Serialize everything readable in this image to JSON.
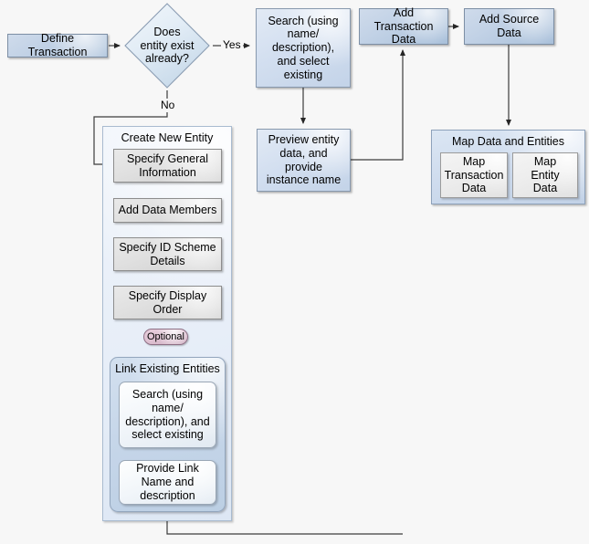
{
  "diagram": {
    "title": "Define Transaction workflow",
    "colors": {
      "background": "#f7f7f7",
      "line": "#3c3c3c",
      "box_blue": "#c2d2e6",
      "box_blue_lite": "#d3dff0",
      "box_grey": "#e0e0e0",
      "container_create": "#e7eef8",
      "container_link": "#c6d6e9",
      "container_map": "#cfdcee",
      "optional_pill": "#ddbfd0"
    }
  },
  "nodes": {
    "define_transaction": "Define Transaction",
    "decision": "Does\nentity exist\nalready?",
    "search_existing": "Search (using\nname/\ndescription),\nand select\nexisting",
    "add_transaction_data": "Add Transaction\nData",
    "add_source_data": "Add Source\nData",
    "preview_entity": "Preview entity\ndata, and\nprovide\ninstance name",
    "create_new_entity_title": "Create New Entity",
    "specify_general_information": "Specify General\nInformation",
    "add_data_members": "Add Data Members",
    "specify_id_scheme": "Specify ID Scheme\nDetails",
    "specify_display_order": "Specify Display\nOrder",
    "optional_badge": "Optional",
    "link_existing_entities_title": "Link Existing Entities",
    "link_search_existing": "Search (using\nname/\ndescription), and\nselect existing",
    "provide_link_name": "Provide Link\nName and\ndescription",
    "map_data_and_entities_title": "Map Data and Entities",
    "map_transaction_data": "Map\nTransaction\nData",
    "map_entity_data": "Map\nEntity\nData"
  },
  "edge_labels": {
    "yes": "Yes",
    "no": "No"
  }
}
